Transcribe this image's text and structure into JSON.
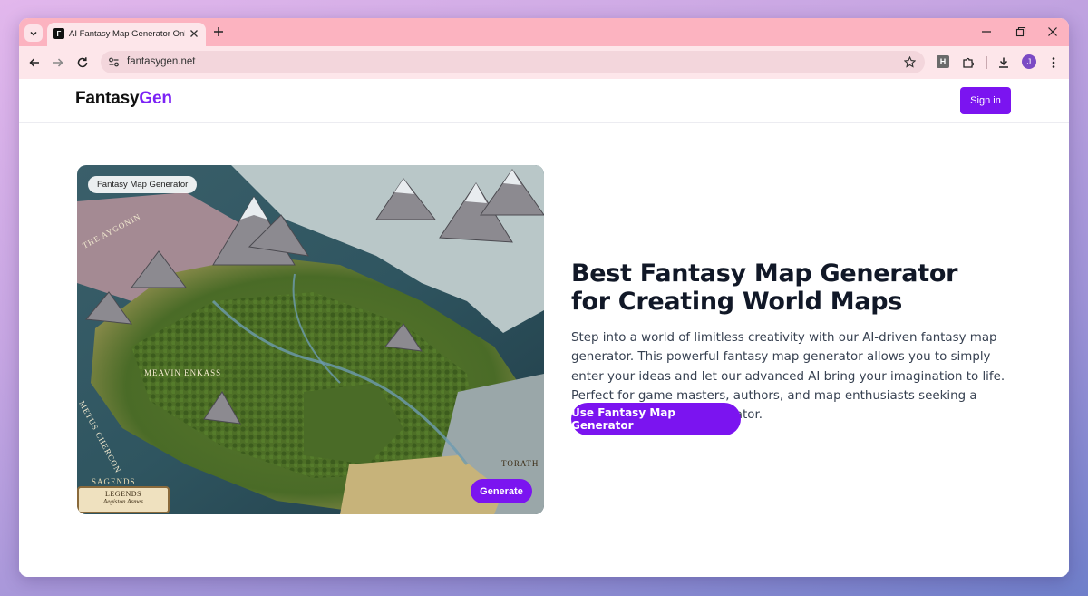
{
  "browser": {
    "tab_title": "AI Fantasy Map Generator Online",
    "favicon_letter": "F",
    "url": "fantasygen.net",
    "extension_letter": "H",
    "profile_initial": "J",
    "colors": {
      "tabbar": "#fcb3c0",
      "toolbar": "#fde6ea",
      "omnibox": "#f3d6dc"
    }
  },
  "site": {
    "logo_part1": "Fantasy",
    "logo_part2": "Gen",
    "signin_label": "Sign in",
    "accent_color": "#7b14f0"
  },
  "hero": {
    "image_badge": "Fantasy Map Generator",
    "image_button": "Generate",
    "legend_title": "LEGENDS",
    "legend_subtitle": "Aegiston Asmes",
    "map_labels": [
      "THE AYGONIN",
      "MEAVIN ENKASS",
      "SAGENDS",
      "TORATH",
      "METUS CHERCON"
    ],
    "heading": "Best Fantasy Map Generator for Creating World Maps",
    "description": "Step into a world of limitless creativity with our AI-driven fantasy map generator. This powerful fantasy map generator allows you to simply enter your ideas and let our advanced AI bring your imagination to life. Perfect for game masters, authors, and map enthusiasts seeking a reliable fantasy map generator.",
    "cta_label": "Use Fantasy Map Generator"
  }
}
